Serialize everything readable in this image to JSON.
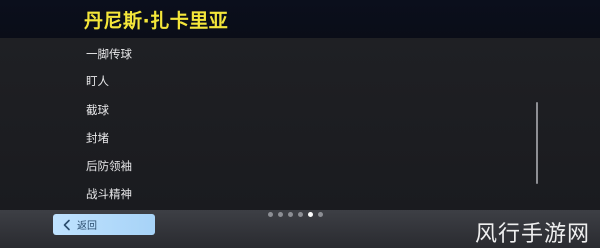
{
  "header": {
    "player_name": "丹尼斯·扎卡里亚"
  },
  "traits": [
    {
      "label": "一脚传球"
    },
    {
      "label": "盯人"
    },
    {
      "label": "截球"
    },
    {
      "label": "封堵"
    },
    {
      "label": "后防领袖"
    },
    {
      "label": "战斗精神"
    }
  ],
  "footer": {
    "back_label": "返回",
    "back_icon": "chevron-left-icon",
    "pager": {
      "total": 6,
      "current": 5
    },
    "watermark": "风行手游网"
  },
  "colors": {
    "name": "#f4e63a",
    "back_button": "#bfe2ff",
    "dot_active": "#ffffff",
    "dot_inactive": "#8c8e94"
  }
}
